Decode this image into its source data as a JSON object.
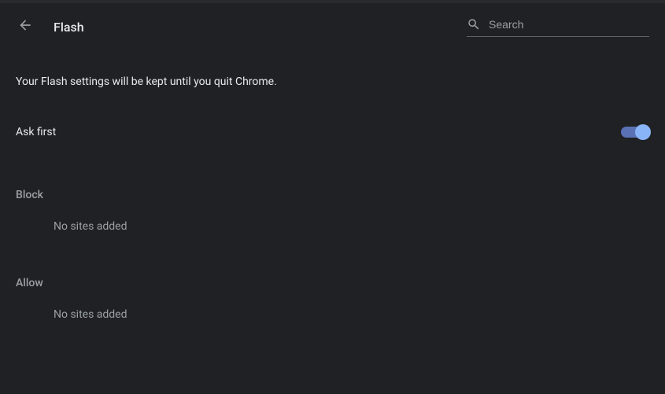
{
  "header": {
    "title": "Flash",
    "search_placeholder": "Search"
  },
  "main": {
    "notice": "Your Flash settings will be kept until you quit Chrome.",
    "ask_first_label": "Ask first",
    "ask_first_enabled": true
  },
  "sections": {
    "block": {
      "title": "Block",
      "empty": "No sites added"
    },
    "allow": {
      "title": "Allow",
      "empty": "No sites added"
    }
  }
}
